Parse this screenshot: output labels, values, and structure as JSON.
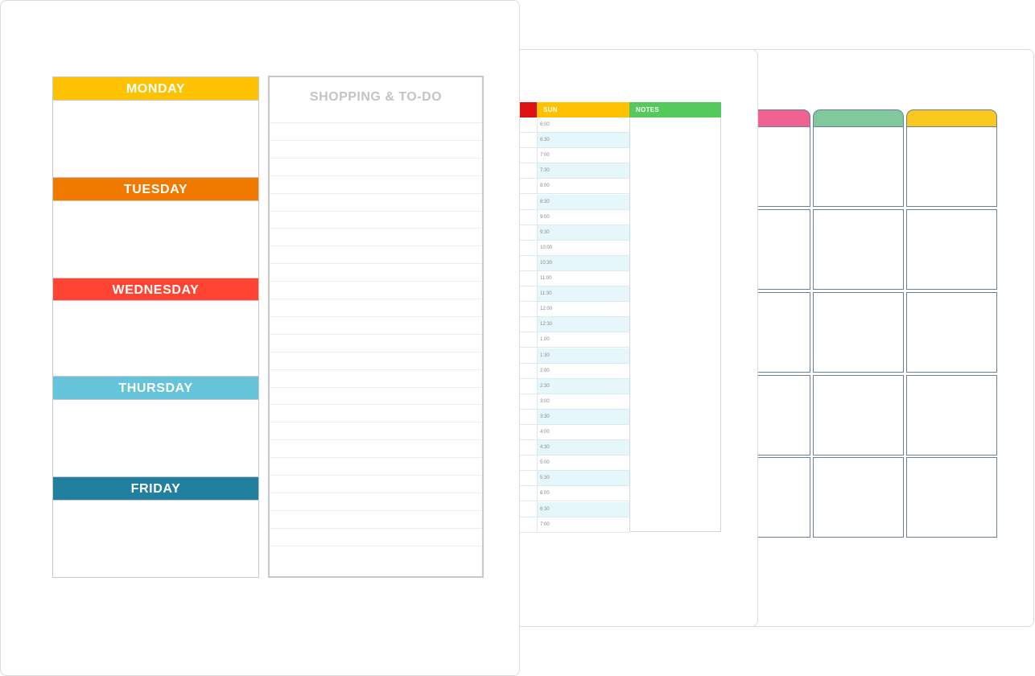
{
  "monthly_sheet": {
    "tab_colors": [
      "#f06292",
      "#81c99c",
      "#f9c81e"
    ]
  },
  "schedule_sheet": {
    "headers": [
      {
        "label": "",
        "color": "#dd1111"
      },
      {
        "label": "SUN",
        "color": "#ffc200"
      },
      {
        "label": "NOTES",
        "color": "#55c95b"
      }
    ],
    "times": [
      "6:00",
      "6:30",
      "7:00",
      "7:30",
      "8:00",
      "8:30",
      "9:00",
      "9:30",
      "10:00",
      "10:30",
      "11:00",
      "11:30",
      "12:00",
      "12:30",
      "1:00",
      "1:30",
      "2:00",
      "2:30",
      "3:00",
      "3:30",
      "4:00",
      "4:30",
      "5:00",
      "5:30",
      "6:00",
      "6:30",
      "7:00"
    ],
    "row_tint": "#e6f7fb"
  },
  "weekly_sheet": {
    "days": [
      {
        "label": "MONDAY",
        "color": "#ffc200"
      },
      {
        "label": "TUESDAY",
        "color": "#f07a00"
      },
      {
        "label": "WEDNESDAY",
        "color": "#ff4433"
      },
      {
        "label": "THURSDAY",
        "color": "#65c4d9"
      },
      {
        "label": "FRIDAY",
        "color": "#2180a0"
      }
    ],
    "todo_title": "SHOPPING & TO-DO"
  }
}
